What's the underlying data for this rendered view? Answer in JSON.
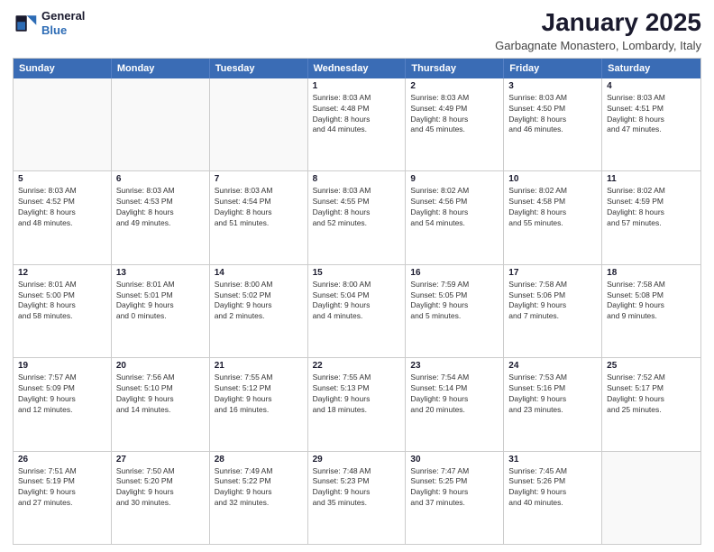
{
  "logo": {
    "line1": "General",
    "line2": "Blue"
  },
  "title": "January 2025",
  "location": "Garbagnate Monastero, Lombardy, Italy",
  "header_days": [
    "Sunday",
    "Monday",
    "Tuesday",
    "Wednesday",
    "Thursday",
    "Friday",
    "Saturday"
  ],
  "weeks": [
    [
      {
        "day": "",
        "info": ""
      },
      {
        "day": "",
        "info": ""
      },
      {
        "day": "",
        "info": ""
      },
      {
        "day": "1",
        "info": "Sunrise: 8:03 AM\nSunset: 4:48 PM\nDaylight: 8 hours\nand 44 minutes."
      },
      {
        "day": "2",
        "info": "Sunrise: 8:03 AM\nSunset: 4:49 PM\nDaylight: 8 hours\nand 45 minutes."
      },
      {
        "day": "3",
        "info": "Sunrise: 8:03 AM\nSunset: 4:50 PM\nDaylight: 8 hours\nand 46 minutes."
      },
      {
        "day": "4",
        "info": "Sunrise: 8:03 AM\nSunset: 4:51 PM\nDaylight: 8 hours\nand 47 minutes."
      }
    ],
    [
      {
        "day": "5",
        "info": "Sunrise: 8:03 AM\nSunset: 4:52 PM\nDaylight: 8 hours\nand 48 minutes."
      },
      {
        "day": "6",
        "info": "Sunrise: 8:03 AM\nSunset: 4:53 PM\nDaylight: 8 hours\nand 49 minutes."
      },
      {
        "day": "7",
        "info": "Sunrise: 8:03 AM\nSunset: 4:54 PM\nDaylight: 8 hours\nand 51 minutes."
      },
      {
        "day": "8",
        "info": "Sunrise: 8:03 AM\nSunset: 4:55 PM\nDaylight: 8 hours\nand 52 minutes."
      },
      {
        "day": "9",
        "info": "Sunrise: 8:02 AM\nSunset: 4:56 PM\nDaylight: 8 hours\nand 54 minutes."
      },
      {
        "day": "10",
        "info": "Sunrise: 8:02 AM\nSunset: 4:58 PM\nDaylight: 8 hours\nand 55 minutes."
      },
      {
        "day": "11",
        "info": "Sunrise: 8:02 AM\nSunset: 4:59 PM\nDaylight: 8 hours\nand 57 minutes."
      }
    ],
    [
      {
        "day": "12",
        "info": "Sunrise: 8:01 AM\nSunset: 5:00 PM\nDaylight: 8 hours\nand 58 minutes."
      },
      {
        "day": "13",
        "info": "Sunrise: 8:01 AM\nSunset: 5:01 PM\nDaylight: 9 hours\nand 0 minutes."
      },
      {
        "day": "14",
        "info": "Sunrise: 8:00 AM\nSunset: 5:02 PM\nDaylight: 9 hours\nand 2 minutes."
      },
      {
        "day": "15",
        "info": "Sunrise: 8:00 AM\nSunset: 5:04 PM\nDaylight: 9 hours\nand 4 minutes."
      },
      {
        "day": "16",
        "info": "Sunrise: 7:59 AM\nSunset: 5:05 PM\nDaylight: 9 hours\nand 5 minutes."
      },
      {
        "day": "17",
        "info": "Sunrise: 7:58 AM\nSunset: 5:06 PM\nDaylight: 9 hours\nand 7 minutes."
      },
      {
        "day": "18",
        "info": "Sunrise: 7:58 AM\nSunset: 5:08 PM\nDaylight: 9 hours\nand 9 minutes."
      }
    ],
    [
      {
        "day": "19",
        "info": "Sunrise: 7:57 AM\nSunset: 5:09 PM\nDaylight: 9 hours\nand 12 minutes."
      },
      {
        "day": "20",
        "info": "Sunrise: 7:56 AM\nSunset: 5:10 PM\nDaylight: 9 hours\nand 14 minutes."
      },
      {
        "day": "21",
        "info": "Sunrise: 7:55 AM\nSunset: 5:12 PM\nDaylight: 9 hours\nand 16 minutes."
      },
      {
        "day": "22",
        "info": "Sunrise: 7:55 AM\nSunset: 5:13 PM\nDaylight: 9 hours\nand 18 minutes."
      },
      {
        "day": "23",
        "info": "Sunrise: 7:54 AM\nSunset: 5:14 PM\nDaylight: 9 hours\nand 20 minutes."
      },
      {
        "day": "24",
        "info": "Sunrise: 7:53 AM\nSunset: 5:16 PM\nDaylight: 9 hours\nand 23 minutes."
      },
      {
        "day": "25",
        "info": "Sunrise: 7:52 AM\nSunset: 5:17 PM\nDaylight: 9 hours\nand 25 minutes."
      }
    ],
    [
      {
        "day": "26",
        "info": "Sunrise: 7:51 AM\nSunset: 5:19 PM\nDaylight: 9 hours\nand 27 minutes."
      },
      {
        "day": "27",
        "info": "Sunrise: 7:50 AM\nSunset: 5:20 PM\nDaylight: 9 hours\nand 30 minutes."
      },
      {
        "day": "28",
        "info": "Sunrise: 7:49 AM\nSunset: 5:22 PM\nDaylight: 9 hours\nand 32 minutes."
      },
      {
        "day": "29",
        "info": "Sunrise: 7:48 AM\nSunset: 5:23 PM\nDaylight: 9 hours\nand 35 minutes."
      },
      {
        "day": "30",
        "info": "Sunrise: 7:47 AM\nSunset: 5:25 PM\nDaylight: 9 hours\nand 37 minutes."
      },
      {
        "day": "31",
        "info": "Sunrise: 7:45 AM\nSunset: 5:26 PM\nDaylight: 9 hours\nand 40 minutes."
      },
      {
        "day": "",
        "info": ""
      }
    ]
  ]
}
